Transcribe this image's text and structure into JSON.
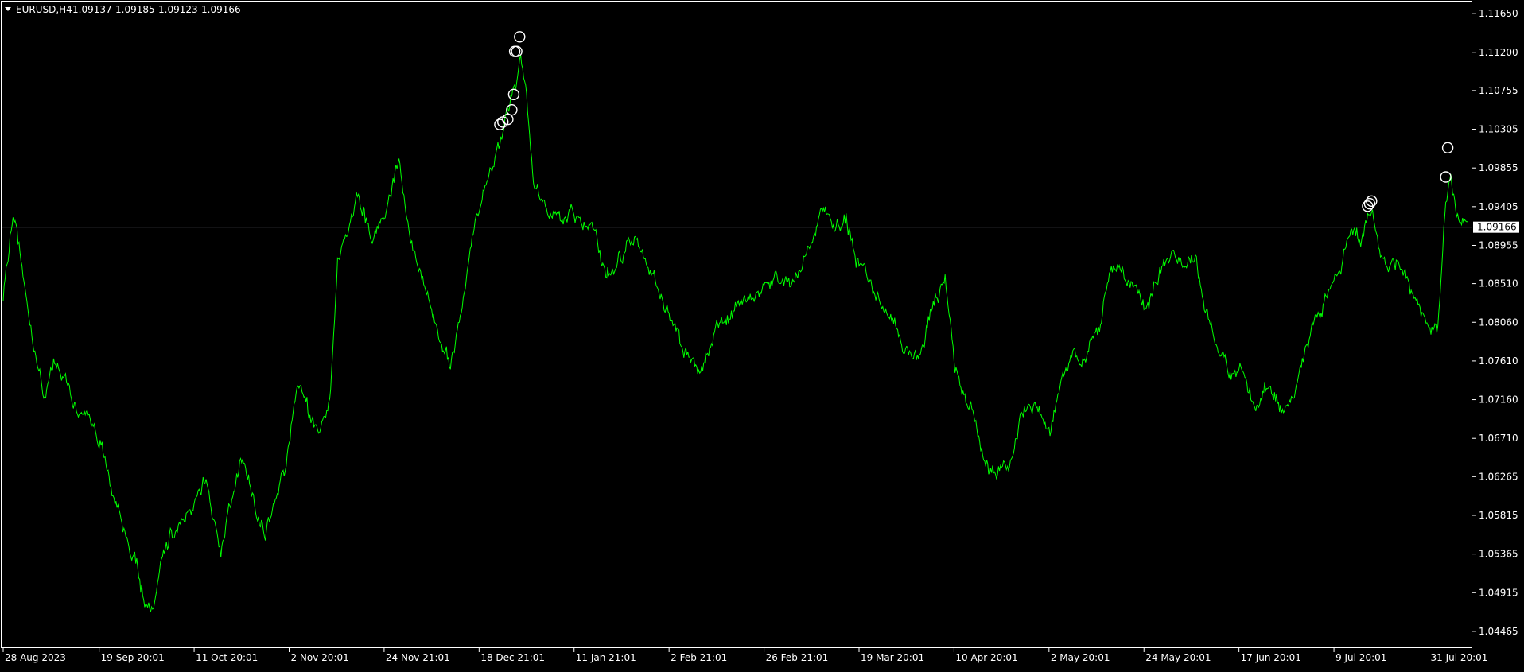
{
  "chart_data": {
    "type": "line",
    "symbol": "EURUSD,H4",
    "ohlc": [
      "1.09137",
      "1.09185",
      "1.09123",
      "1.09166"
    ],
    "current_price_label": "1.09166",
    "current_price": 1.09166,
    "series_color": "#00ff00",
    "marker_color": "#ffffff",
    "price_line_color": "#8a93a5",
    "background": "#000000",
    "ylim": [
      1.0427,
      1.1179
    ],
    "y_ticks": [
      "1.11650",
      "1.11200",
      "1.10755",
      "1.10305",
      "1.09855",
      "1.09405",
      "1.08955",
      "1.08510",
      "1.08060",
      "1.07610",
      "1.07160",
      "1.06710",
      "1.06265",
      "1.05815",
      "1.05365",
      "1.04915",
      "1.04465"
    ],
    "x_ticks": [
      {
        "label": "28 Aug 2023",
        "i": 0
      },
      {
        "label": "19 Sep 20:01",
        "i": 97
      },
      {
        "label": "11 Oct 20:01",
        "i": 193
      },
      {
        "label": "2 Nov 20:01",
        "i": 289
      },
      {
        "label": "24 Nov 21:01",
        "i": 385
      },
      {
        "label": "18 Dec 21:01",
        "i": 481
      },
      {
        "label": "11 Jan 21:01",
        "i": 577
      },
      {
        "label": "2 Feb 21:01",
        "i": 673
      },
      {
        "label": "26 Feb 21:01",
        "i": 769
      },
      {
        "label": "19 Mar 20:01",
        "i": 865
      },
      {
        "label": "10 Apr 20:01",
        "i": 961
      },
      {
        "label": "2 May 20:01",
        "i": 1057
      },
      {
        "label": "24 May 20:01",
        "i": 1153
      },
      {
        "label": "17 Jun 20:01",
        "i": 1249
      },
      {
        "label": "9 Jul 20:01",
        "i": 1345
      },
      {
        "label": "31 Jul 20:01",
        "i": 1441
      }
    ],
    "bar_count": 1480,
    "anchors": [
      [
        0,
        1.0835
      ],
      [
        10,
        1.0936
      ],
      [
        18,
        1.088
      ],
      [
        28,
        1.08
      ],
      [
        40,
        1.0725
      ],
      [
        55,
        1.076
      ],
      [
        68,
        1.072
      ],
      [
        85,
        1.069
      ],
      [
        100,
        1.0655
      ],
      [
        118,
        1.0575
      ],
      [
        135,
        1.0525
      ],
      [
        150,
        1.0462
      ],
      [
        165,
        1.056
      ],
      [
        185,
        1.057
      ],
      [
        205,
        1.063
      ],
      [
        220,
        1.054
      ],
      [
        240,
        1.0645
      ],
      [
        250,
        1.062
      ],
      [
        265,
        1.0555
      ],
      [
        285,
        1.064
      ],
      [
        298,
        1.074
      ],
      [
        315,
        1.0685
      ],
      [
        330,
        1.071
      ],
      [
        338,
        1.088
      ],
      [
        350,
        1.092
      ],
      [
        360,
        1.0955
      ],
      [
        372,
        1.0905
      ],
      [
        388,
        1.0945
      ],
      [
        400,
        1.1005
      ],
      [
        410,
        1.091
      ],
      [
        425,
        1.085
      ],
      [
        440,
        1.079
      ],
      [
        452,
        1.0755
      ],
      [
        465,
        1.0835
      ],
      [
        478,
        1.093
      ],
      [
        490,
        1.0975
      ],
      [
        503,
        1.1015
      ],
      [
        508,
        1.1045
      ],
      [
        513,
        1.1065
      ],
      [
        519,
        1.109
      ],
      [
        523,
        1.112
      ],
      [
        528,
        1.108
      ],
      [
        536,
        1.096
      ],
      [
        548,
        1.0935
      ],
      [
        560,
        1.0925
      ],
      [
        580,
        1.093
      ],
      [
        595,
        1.0915
      ],
      [
        610,
        1.0865
      ],
      [
        625,
        1.088
      ],
      [
        640,
        1.0905
      ],
      [
        652,
        1.087
      ],
      [
        668,
        1.0825
      ],
      [
        688,
        1.078
      ],
      [
        705,
        1.0745
      ],
      [
        720,
        1.079
      ],
      [
        740,
        1.0815
      ],
      [
        758,
        1.083
      ],
      [
        780,
        1.086
      ],
      [
        800,
        1.085
      ],
      [
        815,
        1.0895
      ],
      [
        828,
        1.093
      ],
      [
        840,
        1.0915
      ],
      [
        852,
        1.0935
      ],
      [
        862,
        1.088
      ],
      [
        875,
        1.0855
      ],
      [
        892,
        1.082
      ],
      [
        910,
        1.078
      ],
      [
        925,
        1.076
      ],
      [
        940,
        1.083
      ],
      [
        952,
        1.085
      ],
      [
        962,
        1.0755
      ],
      [
        978,
        1.071
      ],
      [
        990,
        1.0655
      ],
      [
        1005,
        1.062
      ],
      [
        1018,
        1.0655
      ],
      [
        1030,
        1.07
      ],
      [
        1045,
        1.0715
      ],
      [
        1058,
        1.068
      ],
      [
        1070,
        1.074
      ],
      [
        1082,
        1.0775
      ],
      [
        1095,
        1.0765
      ],
      [
        1110,
        1.081
      ],
      [
        1122,
        1.0875
      ],
      [
        1138,
        1.0855
      ],
      [
        1155,
        1.083
      ],
      [
        1168,
        1.086
      ],
      [
        1180,
        1.0895
      ],
      [
        1192,
        1.0875
      ],
      [
        1205,
        1.0885
      ],
      [
        1215,
        1.0825
      ],
      [
        1228,
        1.078
      ],
      [
        1240,
        1.074
      ],
      [
        1252,
        1.075
      ],
      [
        1265,
        1.0705
      ],
      [
        1280,
        1.073
      ],
      [
        1295,
        1.07
      ],
      [
        1310,
        1.075
      ],
      [
        1322,
        1.08
      ],
      [
        1335,
        1.0835
      ],
      [
        1350,
        1.086
      ],
      [
        1362,
        1.0915
      ],
      [
        1372,
        1.0905
      ],
      [
        1382,
        1.0935
      ],
      [
        1392,
        1.089
      ],
      [
        1408,
        1.0875
      ],
      [
        1420,
        1.085
      ],
      [
        1432,
        1.082
      ],
      [
        1442,
        1.079
      ],
      [
        1450,
        1.08
      ],
      [
        1458,
        1.095
      ],
      [
        1463,
        1.0975
      ],
      [
        1470,
        1.092
      ],
      [
        1480,
        1.0915
      ]
    ],
    "arrows": [
      {
        "i": 502,
        "y": 1.1036
      },
      {
        "i": 505,
        "y": 1.1039
      },
      {
        "i": 510,
        "y": 1.1042
      },
      {
        "i": 514,
        "y": 1.1053
      },
      {
        "i": 516,
        "y": 1.1071
      },
      {
        "i": 517,
        "y": 1.1121
      },
      {
        "i": 519,
        "y": 1.1121
      },
      {
        "i": 522,
        "y": 1.1138
      },
      {
        "i": 1379,
        "y": 1.0941
      },
      {
        "i": 1381,
        "y": 1.0944
      },
      {
        "i": 1383,
        "y": 1.0947
      },
      {
        "i": 1458,
        "y": 1.0975
      },
      {
        "i": 1460,
        "y": 1.1009
      }
    ]
  }
}
